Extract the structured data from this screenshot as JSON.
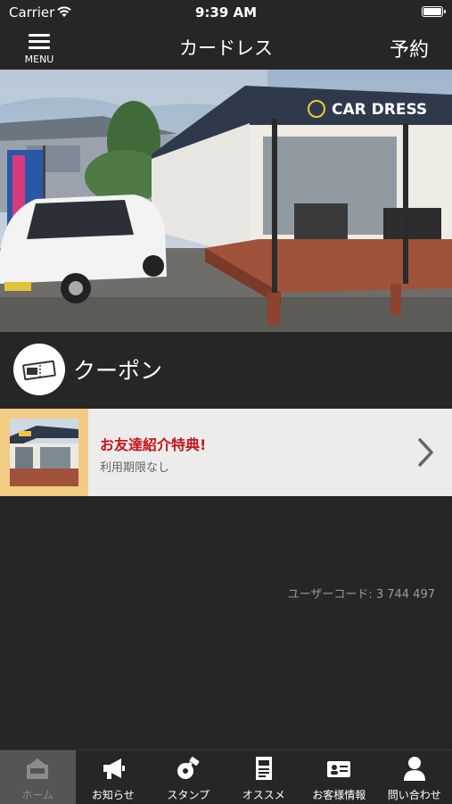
{
  "status_bar": {
    "carrier": "Carrier",
    "time": "9:39 AM"
  },
  "nav": {
    "menu_label": "MENU",
    "title": "カードレス",
    "right_action": "予約"
  },
  "hero": {
    "sign_text": "CAR DRESS",
    "slide_count": 3,
    "active_slide": 1
  },
  "section": {
    "title": "クーポン",
    "icon": "coupon-ticket-icon"
  },
  "coupon": {
    "title": "お友達紹介特典!",
    "validity": "利用期限なし",
    "title_color": "#c4161c"
  },
  "user_code": "ユーザーコード: 3 744 497",
  "tabs": [
    {
      "label": "ホーム",
      "icon": "home-icon",
      "active": true
    },
    {
      "label": "お知らせ",
      "icon": "megaphone-icon",
      "active": false
    },
    {
      "label": "スタンプ",
      "icon": "stamp-icon",
      "active": false
    },
    {
      "label": "オススメ",
      "icon": "newspaper-icon",
      "active": false
    },
    {
      "label": "お客様情報",
      "icon": "id-card-icon",
      "active": false
    },
    {
      "label": "問い合わせ",
      "icon": "person-icon",
      "active": false
    }
  ],
  "colors": {
    "background": "#262626",
    "card": "#ececec",
    "thumb_border": "#f2cc83",
    "accent_red": "#c4161c"
  }
}
